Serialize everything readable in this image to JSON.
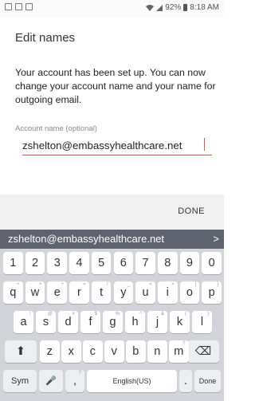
{
  "status_bar": {
    "left_icons": [
      "gallery-icon",
      "copy-icon",
      "image-icon"
    ],
    "battery": "92%",
    "time": "8:18 AM"
  },
  "screen": {
    "title": "Edit names",
    "description": "Your account has been set up. You can now change your account name and your name for outgoing email.",
    "account_field": {
      "label": "Account name (optional)",
      "value": "zshelton@embassyhealthcare.net"
    }
  },
  "action_bar": {
    "done_label": "DONE"
  },
  "suggestion": {
    "text": "zshelton@embassyhealthcare.net",
    "arrow": ">"
  },
  "keyboard": {
    "number_row": [
      "1",
      "2",
      "3",
      "4",
      "5",
      "6",
      "7",
      "8",
      "9",
      "0"
    ],
    "row1": [
      {
        "label": "q",
        "hint": "+"
      },
      {
        "label": "w",
        "hint": "×"
      },
      {
        "label": "e",
        "hint": "÷"
      },
      {
        "label": "r",
        "hint": "="
      },
      {
        "label": "t",
        "hint": "/"
      },
      {
        "label": "y",
        "hint": "_"
      },
      {
        "label": "u",
        "hint": "<"
      },
      {
        "label": "i",
        "hint": ">"
      },
      {
        "label": "o",
        "hint": "["
      },
      {
        "label": "p",
        "hint": "]"
      }
    ],
    "row2": [
      {
        "label": "a",
        "hint": "!"
      },
      {
        "label": "s",
        "hint": "@"
      },
      {
        "label": "d",
        "hint": "#"
      },
      {
        "label": "f",
        "hint": "$"
      },
      {
        "label": "g",
        "hint": "%"
      },
      {
        "label": "h",
        "hint": "^"
      },
      {
        "label": "j",
        "hint": "&"
      },
      {
        "label": "k",
        "hint": "("
      },
      {
        "label": "l",
        "hint": ")"
      }
    ],
    "row3": [
      {
        "label": "z",
        "hint": ""
      },
      {
        "label": "x",
        "hint": ""
      },
      {
        "label": "c",
        "hint": ""
      },
      {
        "label": "v",
        "hint": ""
      },
      {
        "label": "b",
        "hint": ""
      },
      {
        "label": "n",
        "hint": ""
      },
      {
        "label": "m",
        "hint": "?"
      }
    ],
    "shift_symbol": "⬆",
    "backspace_symbol": "⌫",
    "sym_label": "Sym",
    "mic_symbol": "🎤",
    "comma_label": ",",
    "comma_hint": "?",
    "space_label": "English(US)",
    "period_label": ".",
    "done_label": "Done"
  }
}
